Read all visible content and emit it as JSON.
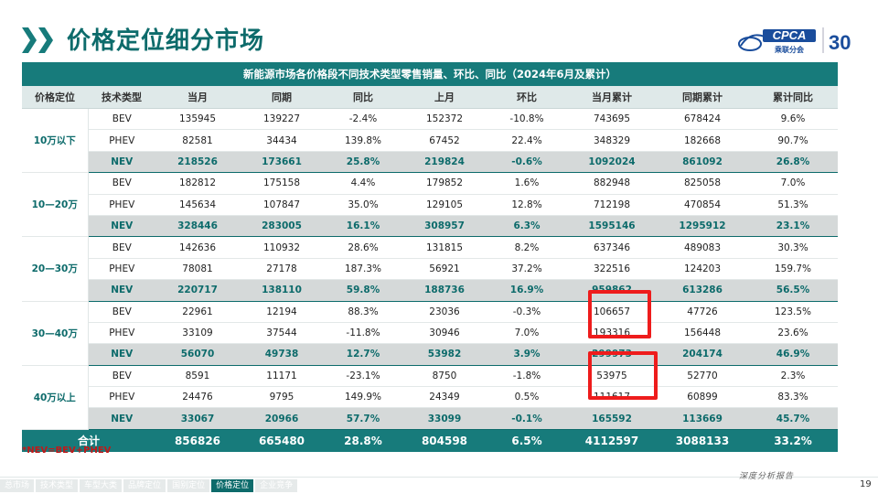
{
  "title": "价格定位细分市场",
  "logo": {
    "brand": "CPCA",
    "brand_cn": "乘联分会",
    "anniversary": "30"
  },
  "table": {
    "caption": "新能源市场各价格段不同技术类型零售销量、环比、同比（2024年6月及累计）",
    "headers": [
      "价格定位",
      "技术类型",
      "当月",
      "同期",
      "同比",
      "上月",
      "环比",
      "当月累计",
      "同期累计",
      "累计同比"
    ],
    "groups": [
      {
        "label": "10万以下",
        "rows": [
          [
            "BEV",
            "135945",
            "139227",
            "-2.4%",
            "152372",
            "-10.8%",
            "743695",
            "678424",
            "9.6%"
          ],
          [
            "PHEV",
            "82581",
            "34434",
            "139.8%",
            "67452",
            "22.4%",
            "348329",
            "182668",
            "90.7%"
          ],
          [
            "NEV",
            "218526",
            "173661",
            "25.8%",
            "219824",
            "-0.6%",
            "1092024",
            "861092",
            "26.8%"
          ]
        ]
      },
      {
        "label": "10—20万",
        "rows": [
          [
            "BEV",
            "182812",
            "175158",
            "4.4%",
            "179852",
            "1.6%",
            "882948",
            "825058",
            "7.0%"
          ],
          [
            "PHEV",
            "145634",
            "107847",
            "35.0%",
            "129105",
            "12.8%",
            "712198",
            "470854",
            "51.3%"
          ],
          [
            "NEV",
            "328446",
            "283005",
            "16.1%",
            "308957",
            "6.3%",
            "1595146",
            "1295912",
            "23.1%"
          ]
        ]
      },
      {
        "label": "20—30万",
        "rows": [
          [
            "BEV",
            "142636",
            "110932",
            "28.6%",
            "131815",
            "8.2%",
            "637346",
            "489083",
            "30.3%"
          ],
          [
            "PHEV",
            "78081",
            "27178",
            "187.3%",
            "56921",
            "37.2%",
            "322516",
            "124203",
            "159.7%"
          ],
          [
            "NEV",
            "220717",
            "138110",
            "59.8%",
            "188736",
            "16.9%",
            "959862",
            "613286",
            "56.5%"
          ]
        ]
      },
      {
        "label": "30—40万",
        "rows": [
          [
            "BEV",
            "22961",
            "12194",
            "88.3%",
            "23036",
            "-0.3%",
            "106657",
            "47726",
            "123.5%"
          ],
          [
            "PHEV",
            "33109",
            "37544",
            "-11.8%",
            "30946",
            "7.0%",
            "193316",
            "156448",
            "23.6%"
          ],
          [
            "NEV",
            "56070",
            "49738",
            "12.7%",
            "53982",
            "3.9%",
            "299973",
            "204174",
            "46.9%"
          ]
        ]
      },
      {
        "label": "40万以上",
        "rows": [
          [
            "BEV",
            "8591",
            "11171",
            "-23.1%",
            "8750",
            "-1.8%",
            "53975",
            "52770",
            "2.3%"
          ],
          [
            "PHEV",
            "24476",
            "9795",
            "149.9%",
            "24349",
            "0.5%",
            "111617",
            "60899",
            "83.3%"
          ],
          [
            "NEV",
            "33067",
            "20966",
            "57.7%",
            "33099",
            "-0.1%",
            "165592",
            "113669",
            "45.7%"
          ]
        ]
      }
    ],
    "total": [
      "合计",
      "856826",
      "665480",
      "28.8%",
      "804598",
      "6.5%",
      "4112597",
      "3088133",
      "33.2%"
    ]
  },
  "footnote": "*NEV=BEV+PHEV",
  "bottom_nav": [
    {
      "label": "总市场",
      "active": false
    },
    {
      "label": "技术类型",
      "active": false
    },
    {
      "label": "车型大类",
      "active": false
    },
    {
      "label": "品牌定位",
      "active": false
    },
    {
      "label": "国别定位",
      "active": false
    },
    {
      "label": "价格定位",
      "active": true
    },
    {
      "label": "企业竞争",
      "active": false
    }
  ],
  "slogan": "深度分析报告",
  "page_number": "19",
  "colors": {
    "accent": "#177b7b",
    "dark_accent": "#0d6b6b",
    "highlight": "#ee1c1c"
  }
}
